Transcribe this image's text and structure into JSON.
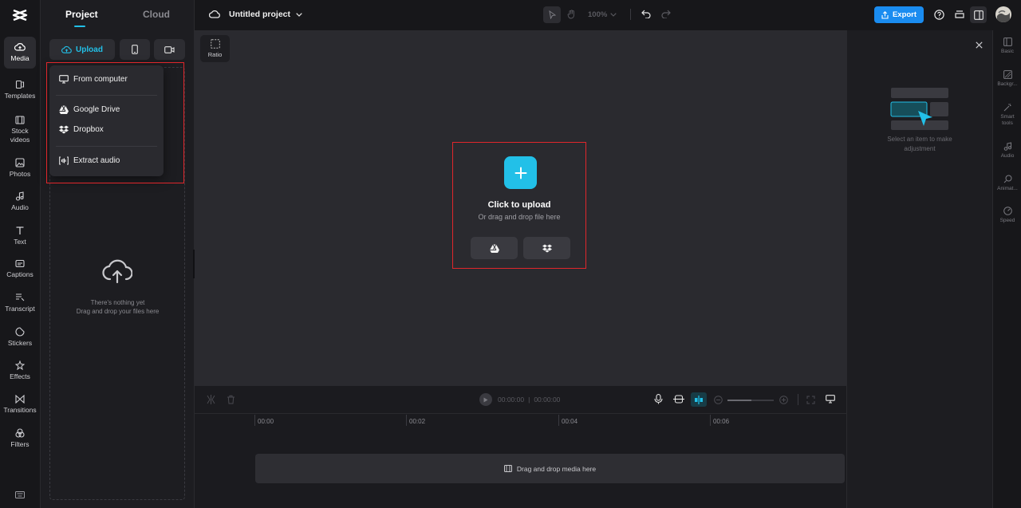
{
  "leftnav": {
    "items": [
      {
        "label": "Media",
        "icon": "media-upload-icon"
      },
      {
        "label": "Templates",
        "icon": "templates-icon"
      },
      {
        "label": "Stock videos",
        "icon": "film-icon"
      },
      {
        "label": "Photos",
        "icon": "photo-icon"
      },
      {
        "label": "Audio",
        "icon": "music-note-icon"
      },
      {
        "label": "Text",
        "icon": "text-icon"
      },
      {
        "label": "Captions",
        "icon": "captions-icon"
      },
      {
        "label": "Transcript",
        "icon": "transcript-icon"
      },
      {
        "label": "Stickers",
        "icon": "sticker-icon"
      },
      {
        "label": "Effects",
        "icon": "effects-icon"
      },
      {
        "label": "Transitions",
        "icon": "transitions-icon"
      },
      {
        "label": "Filters",
        "icon": "filters-icon"
      }
    ]
  },
  "panel": {
    "tabs": [
      {
        "label": "Project"
      },
      {
        "label": "Cloud"
      }
    ],
    "upload_label": "Upload",
    "empty_title": "There's nothing yet",
    "empty_subtitle": "Drag and drop your files here",
    "menu": {
      "items": [
        {
          "label": "From computer",
          "icon": "monitor-icon"
        },
        {
          "label": "Google Drive",
          "icon": "google-drive-icon"
        },
        {
          "label": "Dropbox",
          "icon": "dropbox-icon"
        },
        {
          "label": "Extract audio",
          "icon": "extract-audio-icon"
        }
      ]
    }
  },
  "topbar": {
    "project_title": "Untitled project",
    "zoom": "100%",
    "export_label": "Export"
  },
  "canvas": {
    "ratio_label": "Ratio",
    "upload_title": "Click to upload",
    "upload_subtitle": "Or drag and drop file here"
  },
  "rightpanel": {
    "hint": "Select an item to make adjustment"
  },
  "rightnav": {
    "items": [
      {
        "label": "Basic"
      },
      {
        "label": "Backgr..."
      },
      {
        "label": "Smart tools"
      },
      {
        "label": "Audio"
      },
      {
        "label": "Animat..."
      },
      {
        "label": "Speed"
      }
    ]
  },
  "timeline": {
    "current_time": "00:00:00",
    "total_time": "00:00:00",
    "ticks": [
      "00:00",
      "00:02",
      "00:04",
      "00:06"
    ],
    "track_hint": "Drag and drop media here"
  },
  "colors": {
    "accent": "#22c0e8",
    "export_button": "#1a8cf0",
    "highlight_box": "#e0262b"
  }
}
